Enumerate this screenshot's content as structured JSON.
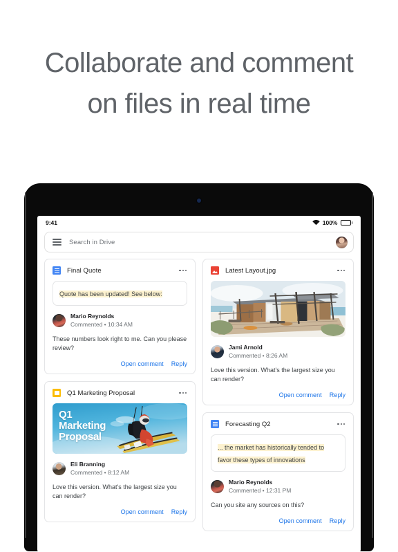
{
  "hero": {
    "line1": "Collaborate and comment",
    "line2": "on files in real time"
  },
  "device": {
    "statusbar": {
      "time": "9:41",
      "battery_percent": "100%",
      "wifi_icon": "wifi-icon",
      "battery_icon": "battery-full-icon"
    }
  },
  "search": {
    "placeholder": "Search in Drive",
    "menu_icon": "hamburger-menu-icon",
    "avatar": "user-avatar"
  },
  "cards": [
    {
      "id": "final-quote",
      "title": "Final Quote",
      "file_icon": "google-docs-icon",
      "file_icon_color": "#4285f4",
      "quote": "Quote has been updated! See below:",
      "commenter": "Mario Reynolds",
      "meta": "Commented • 10:34 AM",
      "body": "These numbers look right to me. Can you please review?",
      "open_label": "Open comment",
      "reply_label": "Reply",
      "more_icon": "more-options-icon"
    },
    {
      "id": "q1-marketing-proposal",
      "title": "Q1 Marketing Proposal",
      "file_icon": "google-slides-icon",
      "file_icon_color": "#fbbc04",
      "slide_title_line1": "Q1",
      "slide_title_line2": "Marketing",
      "slide_title_line3": "Proposal",
      "thumbnail": "skier-jumping-photo",
      "commenter": "Eli Branning",
      "meta": "Commented • 8:12 AM",
      "body": "Love this version. What's the largest size you can render?",
      "open_label": "Open comment",
      "reply_label": "Reply",
      "more_icon": "more-options-icon"
    },
    {
      "id": "latest-layout",
      "title": "Latest Layout.jpg",
      "file_icon": "image-file-icon",
      "file_icon_color": "#ea4335",
      "thumbnail": "architectural-beach-house-rendering",
      "commenter": "Jami Arnold",
      "meta": "Commented • 8:26 AM",
      "body": "Love this version. What's the largest size you can render?",
      "open_label": "Open comment",
      "reply_label": "Reply",
      "more_icon": "more-options-icon"
    },
    {
      "id": "forecasting-q2",
      "title": "Forecasting Q2",
      "file_icon": "google-docs-icon",
      "file_icon_color": "#4285f4",
      "quote": "... the market has historically tended to favor these types of innovations",
      "commenter": "Mario Reynolds",
      "meta": "Commented • 12:31 PM",
      "body": "Can you site any sources on this?",
      "open_label": "Open comment",
      "reply_label": "Reply",
      "more_icon": "more-options-icon"
    }
  ],
  "colors": {
    "link": "#1a73e8",
    "headline": "#5f6368",
    "highlight": "#fdf2cf"
  }
}
